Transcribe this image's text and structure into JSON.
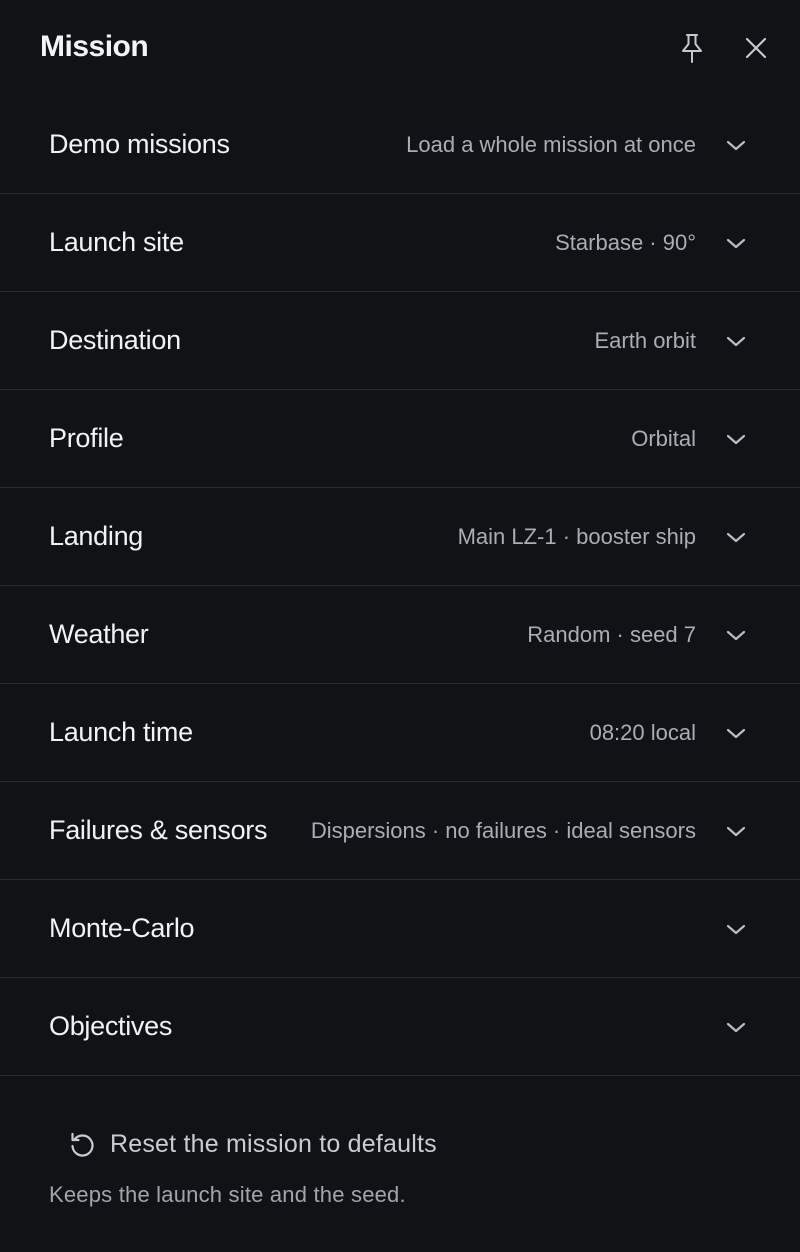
{
  "header": {
    "title": "Mission",
    "icons": {
      "pin": "pin-icon",
      "close": "close-icon"
    }
  },
  "sections": [
    {
      "label": "Demo missions",
      "value": "Load a whole mission at once"
    },
    {
      "label": "Launch site",
      "value": "Starbase · 90°"
    },
    {
      "label": "Destination",
      "value": "Earth orbit"
    },
    {
      "label": "Profile",
      "value": "Orbital"
    },
    {
      "label": "Landing",
      "value": "Main LZ-1 · booster ship"
    },
    {
      "label": "Weather",
      "value": "Random · seed 7"
    },
    {
      "label": "Launch time",
      "value": "08:20 local"
    },
    {
      "label": "Failures & sensors",
      "value": "Dispersions · no failures · ideal sensors"
    },
    {
      "label": "Monte-Carlo",
      "value": ""
    },
    {
      "label": "Objectives",
      "value": ""
    }
  ],
  "footer": {
    "reset_label": "Reset the mission to defaults",
    "note": "Keeps the launch site and the seed."
  },
  "colors": {
    "background": "#111216",
    "divider": "#262930",
    "label": "#f1f2f5",
    "value": "#a9adb7"
  }
}
